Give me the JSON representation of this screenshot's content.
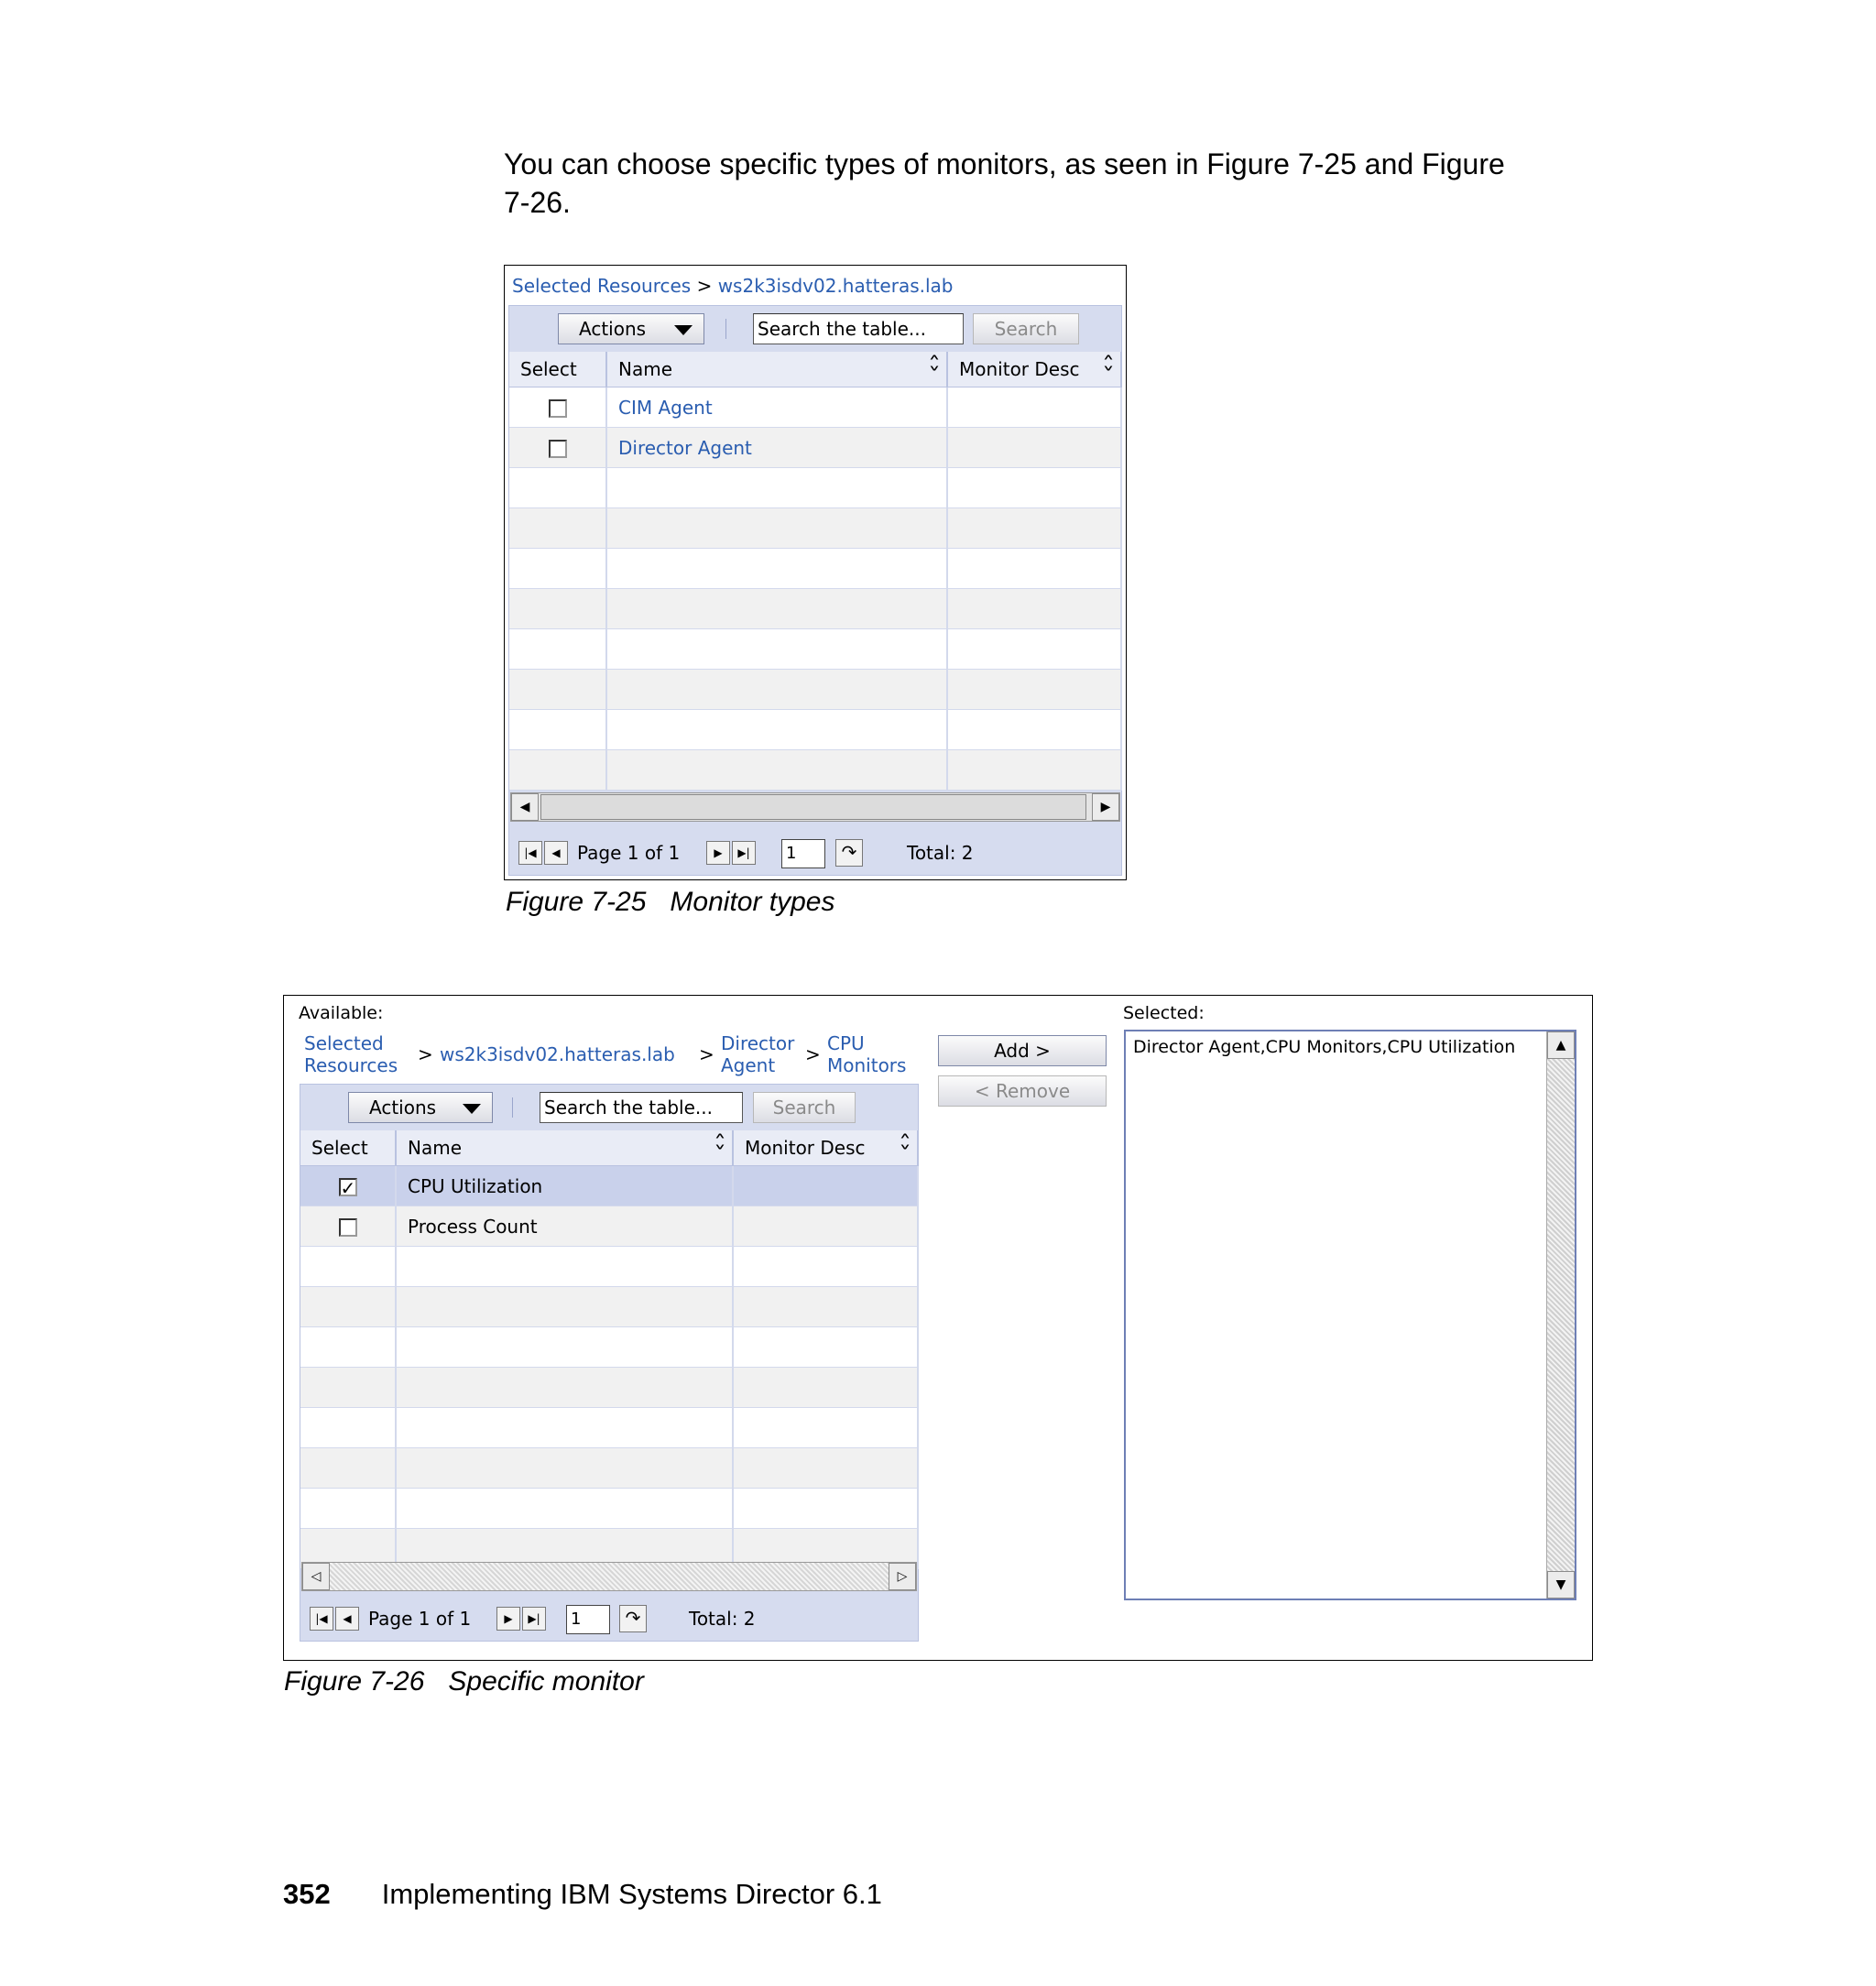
{
  "intro_text": "You can choose specific types of monitors, as seen in Figure 7-25 and Figure 7-26.",
  "figure1": {
    "breadcrumb": {
      "link1": "Selected Resources",
      "sep": ">",
      "link2": "ws2k3isdv02.hatteras.lab"
    },
    "toolbar": {
      "actions_label": "Actions",
      "search_placeholder": "Search the table...",
      "search_button": "Search"
    },
    "columns": [
      "Select",
      "Name",
      "Monitor Desc"
    ],
    "rows": [
      {
        "name": "CIM Agent",
        "checked": false
      },
      {
        "name": "Director Agent",
        "checked": false
      }
    ],
    "pager": {
      "page_text": "Page 1 of 1",
      "page_input": "1",
      "total": "Total: 2"
    },
    "caption_number": "Figure 7-25",
    "caption_title": "Monitor types"
  },
  "figure2": {
    "available_label": "Available:",
    "selected_label": "Selected:",
    "breadcrumb": {
      "link1_line1": "Selected",
      "link1_line2": "Resources",
      "sep": ">",
      "link2": "ws2k3isdv02.hatteras.lab",
      "link3_line1": "Director",
      "link3_line2": "Agent",
      "link4_line1": "CPU",
      "link4_line2": "Monitors"
    },
    "toolbar": {
      "actions_label": "Actions",
      "search_placeholder": "Search the table...",
      "search_button": "Search"
    },
    "columns": [
      "Select",
      "Name",
      "Monitor Desc"
    ],
    "rows": [
      {
        "name": "CPU Utilization",
        "checked": true
      },
      {
        "name": "Process Count",
        "checked": false
      }
    ],
    "pager": {
      "page_text": "Page 1 of 1",
      "page_input": "1",
      "total": "Total: 2"
    },
    "add_button": "Add >",
    "remove_button": "< Remove",
    "selected_item": "Director Agent,CPU Monitors,CPU Utilization",
    "caption_number": "Figure 7-26",
    "caption_title": "Specific monitor"
  },
  "footer": {
    "page_number": "352",
    "book_title": "Implementing IBM Systems Director 6.1"
  },
  "colors": {
    "link": "#2a5db0",
    "panel": "#d6dcef",
    "selected_row": "#c9d1eb"
  },
  "icons": [
    "dropdown-arrow-icon",
    "sort-icon",
    "checkbox-icon",
    "first-page-icon",
    "prev-page-icon",
    "next-page-icon",
    "last-page-icon",
    "go-icon",
    "scroll-left-icon",
    "scroll-right-icon",
    "scroll-up-icon",
    "scroll-down-icon"
  ]
}
